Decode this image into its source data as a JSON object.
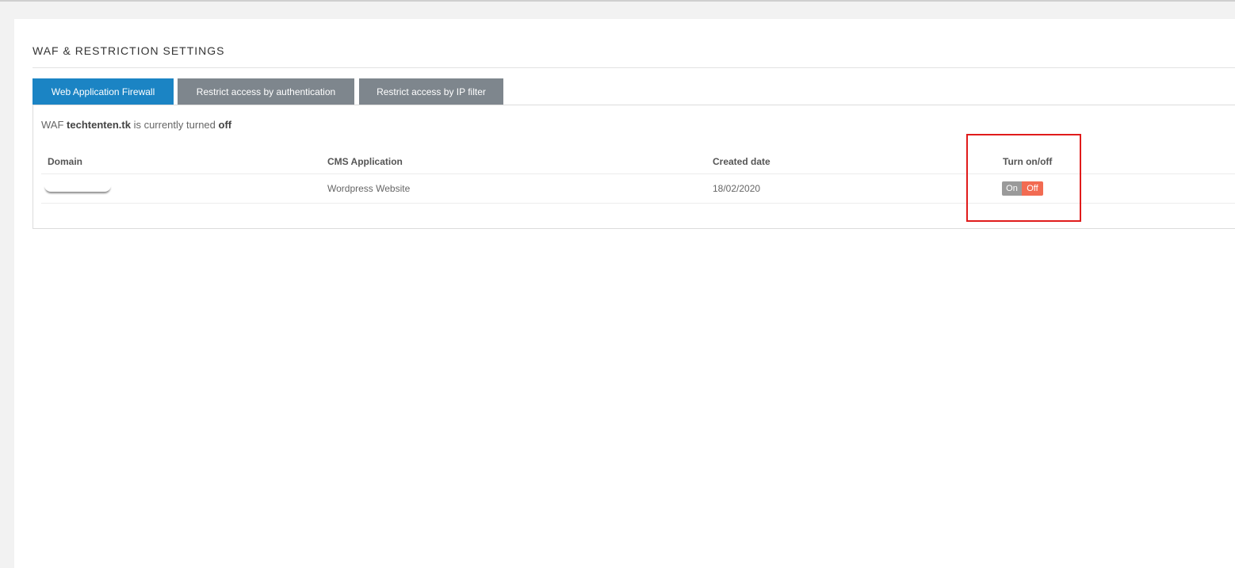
{
  "page": {
    "section_title": "WAF & RESTRICTION SETTINGS"
  },
  "tabs": [
    {
      "label": "Web Application Firewall",
      "active": true
    },
    {
      "label": "Restrict access by authentication",
      "active": false
    },
    {
      "label": "Restrict access by IP filter",
      "active": false
    }
  ],
  "status": {
    "prefix": "WAF",
    "domain": "techtenten.tk",
    "middle": "is currently turned",
    "state": "off"
  },
  "table": {
    "headers": {
      "domain": "Domain",
      "cms": "CMS Application",
      "created": "Created date",
      "toggle": "Turn on/off"
    },
    "rows": [
      {
        "cms": "Wordpress Website",
        "created": "18/02/2020",
        "toggle_on_label": "On",
        "toggle_off_label": "Off",
        "toggle_state": "off"
      }
    ]
  },
  "colors": {
    "tab_active": "#1b84c4",
    "tab_inactive": "#7e868d",
    "toggle_off": "#f26b52",
    "toggle_on_inactive": "#9a9a9a",
    "highlight_box": "#e01b1b"
  }
}
